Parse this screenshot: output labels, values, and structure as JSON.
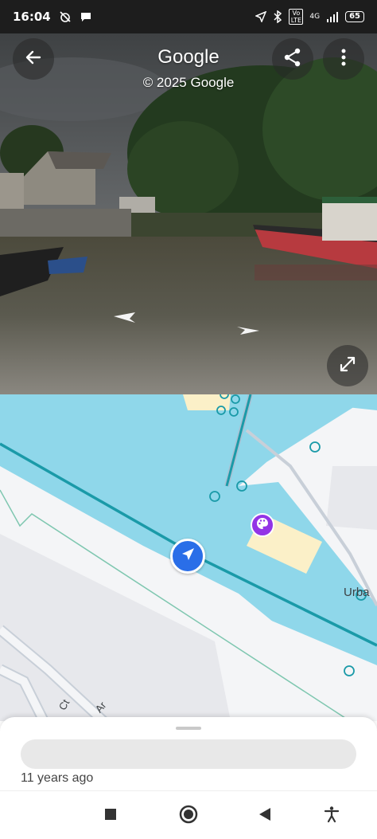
{
  "status_bar": {
    "time": "16:04",
    "battery": "65",
    "network": "4G",
    "volte": "Vo LTE",
    "icons": [
      "alarm-off-icon",
      "chat-bubble-icon",
      "location-icon",
      "bluetooth-icon",
      "signal-icon",
      "battery-icon"
    ]
  },
  "street_view": {
    "title": "Google",
    "copyright": "© 2025 Google",
    "buttons": [
      "back-arrow-icon",
      "share-icon",
      "more-vert-icon",
      "fullscreen-icon"
    ]
  },
  "map": {
    "label_partial": "Urba",
    "poi_icon": "palette-icon",
    "marker_icon": "navigation-arrow-icon",
    "road_label_1": "Ct",
    "road_label_2": "Ar",
    "colors": {
      "water": "#8fd7ea",
      "canal_line": "#1a9aa8",
      "marker": "#2a6ee8",
      "poi": "#9334e6"
    }
  },
  "bottom_sheet": {
    "date": "11 years ago"
  },
  "nav_bar": {
    "buttons": [
      "recent-apps-icon",
      "home-icon",
      "back-icon",
      "accessibility-icon"
    ]
  }
}
